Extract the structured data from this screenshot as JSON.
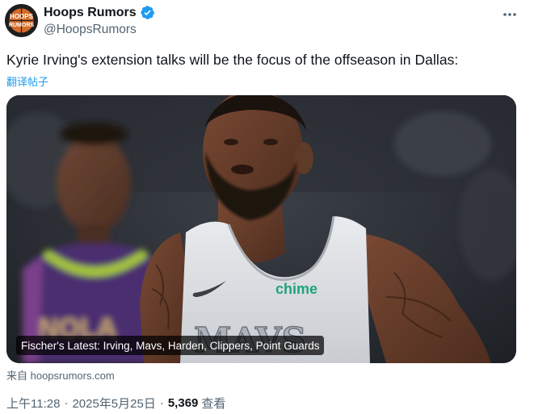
{
  "author": {
    "display_name": "Hoops Rumors",
    "handle": "@HoopsRumors",
    "avatar_text_top": "HOOPS",
    "avatar_text_bottom": "RUMORS",
    "verified": true
  },
  "icons": {
    "verified": "verified-badge-icon",
    "more": "more-options-icon"
  },
  "tweet": {
    "text": "Kyrie Irving's extension talks will be the focus of the offseason in Dallas:",
    "translate_label": "翻译帖子"
  },
  "card": {
    "caption": "Fischer's Latest: Irving, Mavs, Harden, Clippers, Point Guards",
    "jersey_brand": "chime",
    "jersey_text": "MAVS",
    "bg_jersey_text": "NOLA",
    "source": "来自 hoopsrumors.com"
  },
  "meta": {
    "time": "上午11:28",
    "date": "2025年5月25日",
    "views_count": "5,369",
    "views_label": "查看"
  },
  "colors": {
    "accent": "#1d9bf0",
    "text": "#0f1419",
    "secondary": "#536471"
  }
}
